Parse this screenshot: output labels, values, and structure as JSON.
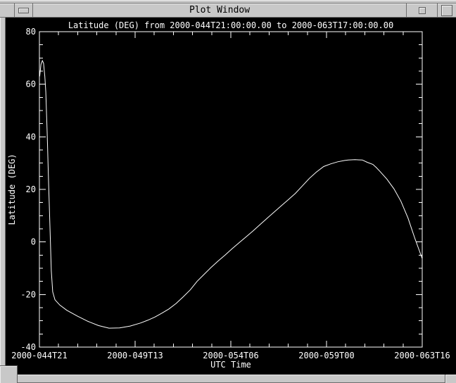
{
  "window": {
    "title": "Plot Window"
  },
  "colors": {
    "frame": "#c8c8c8",
    "frame_highlight": "#ececec",
    "frame_shadow": "#6e6e6e",
    "canvas_bg": "#000000",
    "plot_fg": "#ffffff"
  },
  "chart_data": {
    "type": "line",
    "title": "Latitude (DEG) from 2000-044T21:00:00.00 to 2000-063T17:00:00.00",
    "xlabel": "UTC Time",
    "ylabel": "Latitude (DEG)",
    "xlim": [
      44.875,
      63.7083
    ],
    "ylim": [
      -40,
      80
    ],
    "grid": false,
    "legend": "none",
    "x_ticks": {
      "values": [
        44.875,
        49.5833,
        54.2917,
        59.0,
        63.7083
      ],
      "labels": [
        "2000-044T21",
        "2000-049T13",
        "2000-054T06",
        "2000-059T00",
        "2000-063T16"
      ],
      "minor_intervals": 5
    },
    "y_ticks": {
      "values": [
        80,
        60,
        40,
        20,
        0,
        -20,
        -40
      ],
      "labels": [
        "80",
        "60",
        "40",
        "20",
        "0",
        "-20",
        "-40"
      ],
      "minor_intervals": 4
    },
    "series": [
      {
        "name": "latitude",
        "color": "#ffffff",
        "points": [
          [
            44.89,
            63
          ],
          [
            44.95,
            67.5
          ],
          [
            45.02,
            69
          ],
          [
            45.08,
            68
          ],
          [
            45.14,
            63
          ],
          [
            45.19,
            57
          ],
          [
            45.26,
            41
          ],
          [
            45.33,
            22
          ],
          [
            45.4,
            4
          ],
          [
            45.46,
            -11
          ],
          [
            45.53,
            -19
          ],
          [
            45.64,
            -22
          ],
          [
            45.88,
            -24
          ],
          [
            46.22,
            -26
          ],
          [
            46.74,
            -28.2
          ],
          [
            47.26,
            -30.2
          ],
          [
            47.78,
            -31.8
          ],
          [
            48.3,
            -32.8
          ],
          [
            48.82,
            -32.7
          ],
          [
            49.34,
            -32.0
          ],
          [
            49.86,
            -30.8
          ],
          [
            50.2,
            -29.8
          ],
          [
            50.55,
            -28.6
          ],
          [
            50.9,
            -27.1
          ],
          [
            51.24,
            -25.5
          ],
          [
            51.6,
            -23.4
          ],
          [
            51.93,
            -21.0
          ],
          [
            52.3,
            -18.2
          ],
          [
            52.63,
            -15.0
          ],
          [
            52.98,
            -12.3
          ],
          [
            53.32,
            -9.7
          ],
          [
            53.66,
            -7.3
          ],
          [
            54.01,
            -5.0
          ],
          [
            54.35,
            -2.6
          ],
          [
            54.7,
            -0.3
          ],
          [
            55.05,
            2.0
          ],
          [
            55.4,
            4.3
          ],
          [
            55.74,
            6.7
          ],
          [
            56.09,
            9.1
          ],
          [
            56.44,
            11.5
          ],
          [
            56.78,
            13.8
          ],
          [
            57.12,
            16.1
          ],
          [
            57.47,
            18.5
          ],
          [
            57.82,
            21.4
          ],
          [
            58.16,
            24.2
          ],
          [
            58.5,
            26.6
          ],
          [
            58.86,
            28.7
          ],
          [
            59.2,
            29.7
          ],
          [
            59.55,
            30.5
          ],
          [
            59.9,
            31.0
          ],
          [
            60.07,
            31.2
          ],
          [
            60.4,
            31.3
          ],
          [
            60.76,
            31.2
          ],
          [
            61.0,
            30.3
          ],
          [
            61.28,
            29.5
          ],
          [
            61.45,
            28.3
          ],
          [
            61.62,
            26.9
          ],
          [
            61.97,
            23.9
          ],
          [
            62.32,
            20.2
          ],
          [
            62.66,
            15.5
          ],
          [
            63.01,
            9.1
          ],
          [
            63.18,
            5.2
          ],
          [
            63.36,
            1.1
          ],
          [
            63.53,
            -2.5
          ],
          [
            63.7,
            -6.2
          ]
        ]
      }
    ]
  }
}
